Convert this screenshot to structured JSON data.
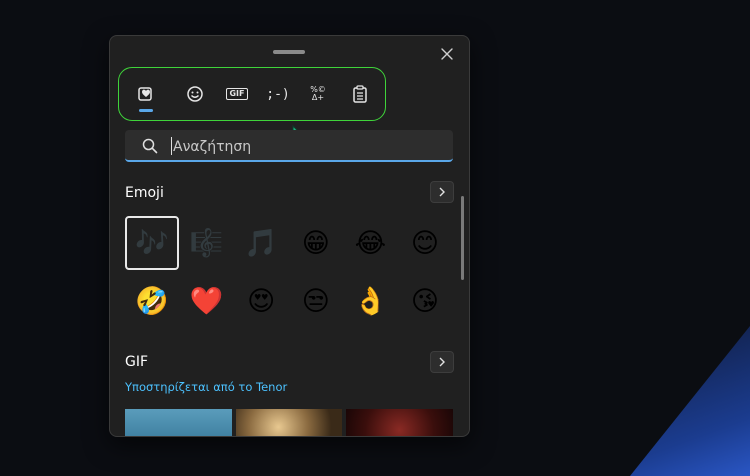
{
  "panel": {
    "close_icon": "close-icon",
    "drag_handle": "drag-handle"
  },
  "tabs": [
    {
      "name": "favorites",
      "icon": "heart-sticky-icon",
      "active": true
    },
    {
      "name": "emoji",
      "icon": "smiley-icon"
    },
    {
      "name": "gif",
      "label": "GIF"
    },
    {
      "name": "kaomoji",
      "label": ";-)"
    },
    {
      "name": "symbols",
      "label": "%©\nΔ+"
    },
    {
      "name": "clipboard",
      "icon": "clipboard-icon"
    }
  ],
  "search": {
    "placeholder": "Αναζήτηση",
    "value": ""
  },
  "emoji_section": {
    "title": "Emoji",
    "items": [
      {
        "char": "🎶",
        "name": "musical-notes",
        "selected": true,
        "dim": true
      },
      {
        "char": "🎼",
        "name": "musical-score",
        "dim": true
      },
      {
        "char": "🎵",
        "name": "musical-note",
        "dim": true
      },
      {
        "char": "😁",
        "name": "beaming-face"
      },
      {
        "char": "😂",
        "name": "tears-of-joy"
      },
      {
        "char": "😊",
        "name": "smiling-face"
      },
      {
        "char": "🤣",
        "name": "rolling-laughing"
      },
      {
        "char": "❤️",
        "name": "red-heart"
      },
      {
        "char": "😍",
        "name": "heart-eyes"
      },
      {
        "char": "😒",
        "name": "unamused-face"
      },
      {
        "char": "👌",
        "name": "ok-hand"
      },
      {
        "char": "😘",
        "name": "blowing-kiss"
      }
    ]
  },
  "gif_section": {
    "title": "GIF",
    "powered_by": "Υποστηρίζεται από το Tenor"
  },
  "colors": {
    "accent": "#5aa7e8",
    "link": "#4cc2ff",
    "highlight": "#3fd43a",
    "panel_bg": "#202020"
  }
}
